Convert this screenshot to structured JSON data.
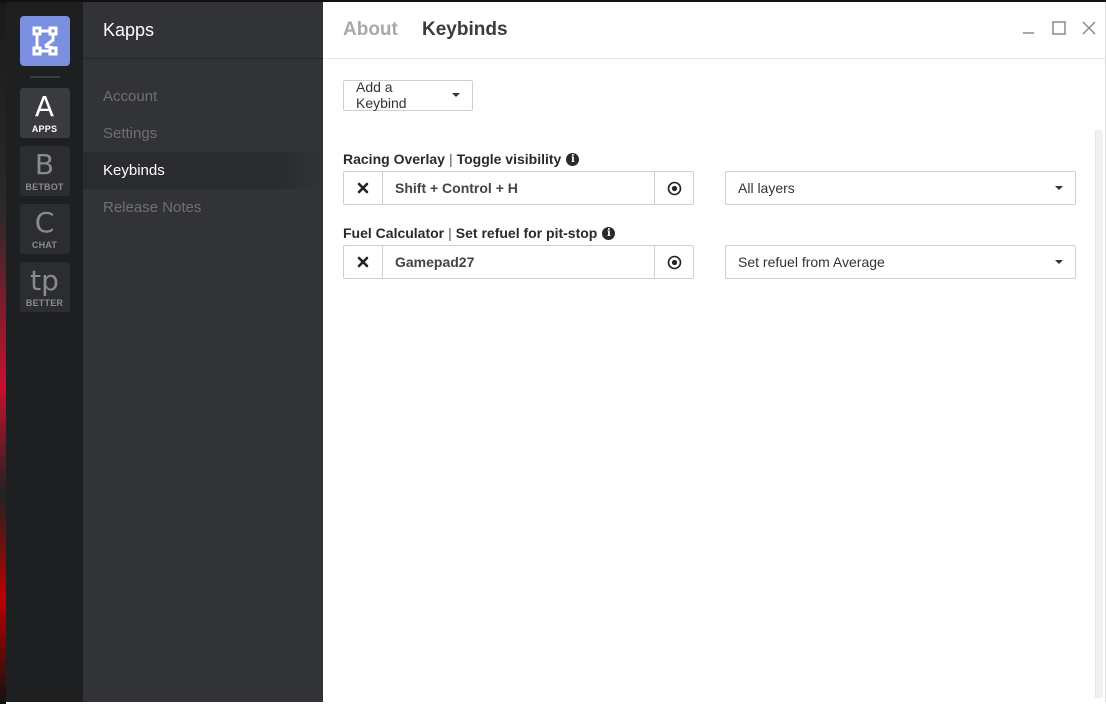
{
  "app": {
    "name": "Kapps"
  },
  "rail": {
    "items": [
      {
        "glyph": "A",
        "label": "APPS",
        "active": true
      },
      {
        "glyph": "B",
        "label": "BETBOT",
        "active": false
      },
      {
        "glyph": "C",
        "label": "CHAT",
        "active": false
      },
      {
        "glyph": "tp",
        "label": "BETTER",
        "active": false
      }
    ]
  },
  "nav": {
    "items": [
      {
        "label": "Account"
      },
      {
        "label": "Settings"
      },
      {
        "label": "Keybinds"
      },
      {
        "label": "Release Notes"
      }
    ]
  },
  "header": {
    "tabs": [
      {
        "label": "About"
      },
      {
        "label": "Keybinds"
      }
    ]
  },
  "toolbar": {
    "add_keybind_label": "Add a Keybind"
  },
  "keybinds": [
    {
      "app": "Racing Overlay",
      "separator": "|",
      "action": "Toggle visibility",
      "value": "Shift + Control + H",
      "option": "All layers"
    },
    {
      "app": "Fuel Calculator",
      "separator": "|",
      "action": "Set refuel for pit-stop",
      "value": "Gamepad27",
      "option": "Set refuel from Average"
    }
  ],
  "colors": {
    "logo_bg": "#7b8fe0",
    "rail_bg": "#1e1f21",
    "nav_bg": "#323337"
  },
  "icons": {
    "clear": "close-x-icon",
    "record": "record-target-icon",
    "info": "info-circle-icon"
  }
}
